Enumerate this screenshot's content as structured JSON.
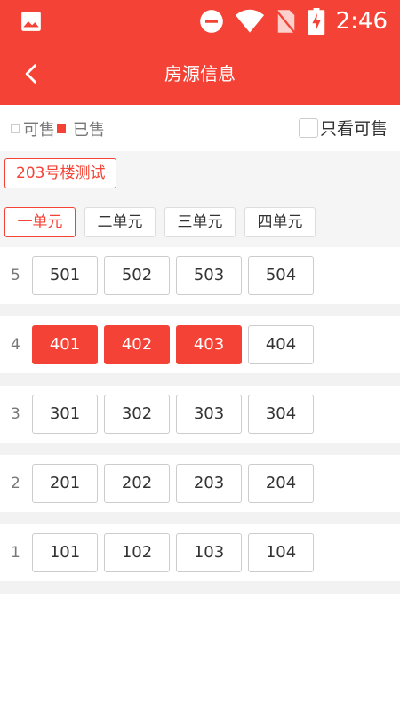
{
  "status_bar": {
    "time": "2:46",
    "icons": [
      "image-icon",
      "do-not-disturb-icon",
      "wifi-icon",
      "no-sim-icon",
      "battery-charging-icon"
    ]
  },
  "app_bar": {
    "title": "房源信息",
    "back_icon": "chevron-left-icon"
  },
  "legend": {
    "available_label": "可售",
    "sold_label": "已售",
    "only_available_label": "只看可售",
    "only_available_checked": false
  },
  "building": {
    "name": "203号楼测试"
  },
  "units": {
    "active_index": 0,
    "tabs": [
      "一单元",
      "二单元",
      "三单元",
      "四单元"
    ]
  },
  "floors": [
    {
      "number": "5",
      "rooms": [
        {
          "no": "501",
          "sold": false
        },
        {
          "no": "502",
          "sold": false
        },
        {
          "no": "503",
          "sold": false
        },
        {
          "no": "504",
          "sold": false
        }
      ]
    },
    {
      "number": "4",
      "rooms": [
        {
          "no": "401",
          "sold": true
        },
        {
          "no": "402",
          "sold": true
        },
        {
          "no": "403",
          "sold": true
        },
        {
          "no": "404",
          "sold": false
        }
      ]
    },
    {
      "number": "3",
      "rooms": [
        {
          "no": "301",
          "sold": false
        },
        {
          "no": "302",
          "sold": false
        },
        {
          "no": "303",
          "sold": false
        },
        {
          "no": "304",
          "sold": false
        }
      ]
    },
    {
      "number": "2",
      "rooms": [
        {
          "no": "201",
          "sold": false
        },
        {
          "no": "202",
          "sold": false
        },
        {
          "no": "203",
          "sold": false
        },
        {
          "no": "204",
          "sold": false
        }
      ]
    },
    {
      "number": "1",
      "rooms": [
        {
          "no": "101",
          "sold": false
        },
        {
          "no": "102",
          "sold": false
        },
        {
          "no": "103",
          "sold": false
        },
        {
          "no": "104",
          "sold": false
        }
      ]
    }
  ],
  "colors": {
    "brand": "#f44336",
    "sold": "#f44336",
    "available_border": "#cccccc",
    "section_bg": "#f5f5f5"
  }
}
